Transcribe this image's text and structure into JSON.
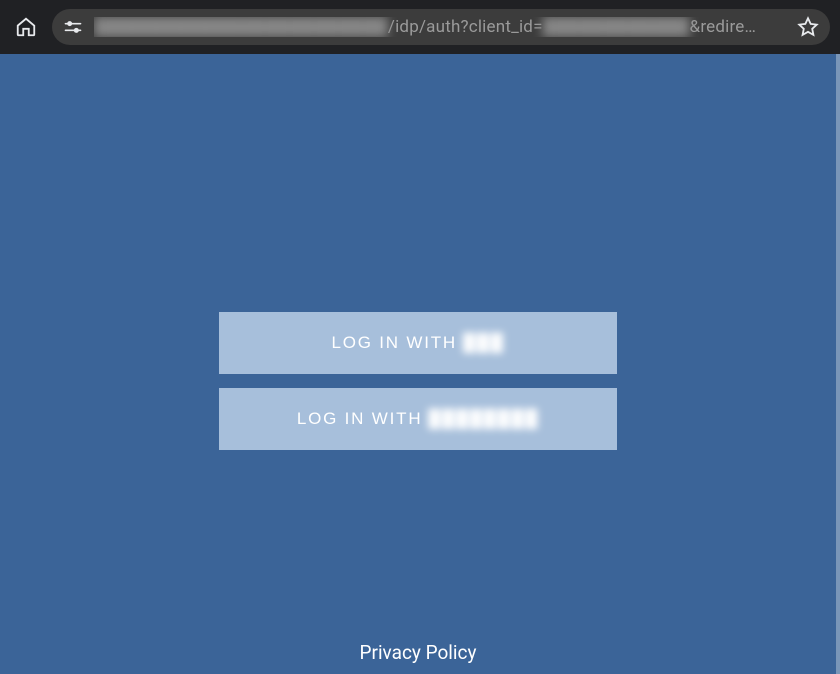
{
  "toolbar": {
    "url_prefix_obscured": "████████████████████████",
    "url_mid": "/idp/auth?client_id=",
    "url_mid_obscured": "████████████",
    "url_tail": "&redire…"
  },
  "login": {
    "button1_prefix": "LOG IN WITH",
    "button1_suffix_obscured": "███",
    "button2_prefix": "LOG IN WITH",
    "button2_suffix_obscured": "████████"
  },
  "footer": {
    "privacy": "Privacy Policy"
  }
}
